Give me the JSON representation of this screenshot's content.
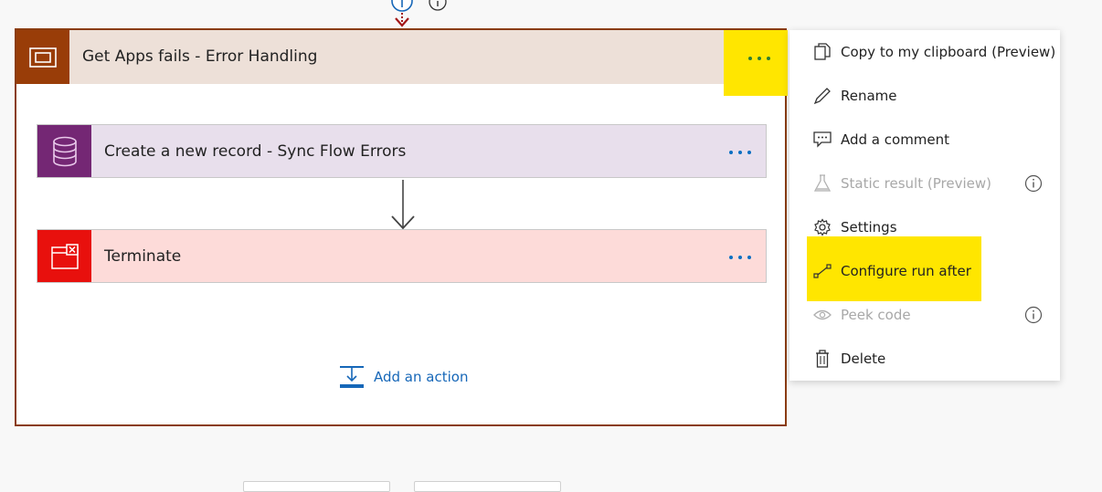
{
  "scope": {
    "title": "Get Apps fails - Error Handling",
    "header_color": "#993d08",
    "header_bg": "#ede0d8",
    "more_icon": "ellipsis-icon"
  },
  "actions": [
    {
      "title": "Create a new record - Sync Flow Errors",
      "icon": "database-icon",
      "icon_bg": "#742774",
      "card_bg": "#e8dfec"
    },
    {
      "title": "Terminate",
      "icon": "terminate-icon",
      "icon_bg": "#e8100d",
      "card_bg": "#fddbd9"
    }
  ],
  "add_action": {
    "label": "Add an action",
    "icon": "add-action-icon"
  },
  "context_menu": {
    "items": [
      {
        "label": "Copy to my clipboard (Preview)",
        "icon": "copy-icon",
        "enabled": true
      },
      {
        "label": "Rename",
        "icon": "pencil-icon",
        "enabled": true
      },
      {
        "label": "Add a comment",
        "icon": "comment-icon",
        "enabled": true
      },
      {
        "label": "Static result (Preview)",
        "icon": "flask-icon",
        "enabled": false,
        "info": true
      },
      {
        "label": "Settings",
        "icon": "gear-icon",
        "enabled": true
      },
      {
        "label": "Configure run after",
        "icon": "run-after-icon",
        "enabled": true,
        "highlighted": true
      },
      {
        "label": "Peek code",
        "icon": "eye-icon",
        "enabled": false,
        "info": true
      },
      {
        "label": "Delete",
        "icon": "trash-icon",
        "enabled": true
      }
    ]
  },
  "colors": {
    "highlight": "#ffe600",
    "link": "#1667b8",
    "accent_blue": "#0a6fc2"
  }
}
